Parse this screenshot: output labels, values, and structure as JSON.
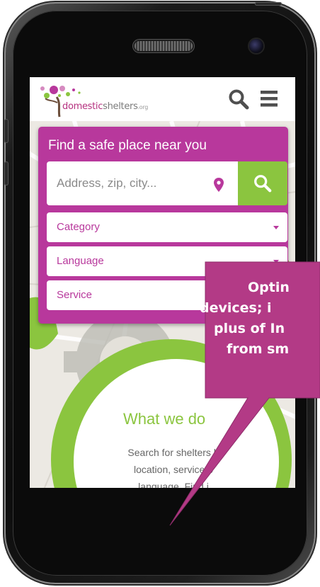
{
  "header": {
    "logo_text_part1": "domestic",
    "logo_text_part2": "shelters",
    "logo_text_part3": ".org",
    "search_icon": "search-icon",
    "menu_icon": "hamburger-menu-icon"
  },
  "search_panel": {
    "title": "Find a safe place near you",
    "address_placeholder": "Address, zip, city...",
    "location_icon": "map-pin-icon",
    "search_button_icon": "search-icon",
    "selects": [
      {
        "label": "Category"
      },
      {
        "label": "Language"
      },
      {
        "label": "Service"
      }
    ]
  },
  "what_we_do": {
    "title": "What we do",
    "line1": "Search for shelters b",
    "line2": "location, service o",
    "line3": "language. Find i"
  },
  "callout": {
    "line1": "Optin",
    "line2": "devices; i",
    "line3": "plus of In",
    "line4": "from sm"
  },
  "colors": {
    "brand_magenta": "#b8389c",
    "brand_green": "#8bc53f",
    "callout": "#b33a86"
  }
}
